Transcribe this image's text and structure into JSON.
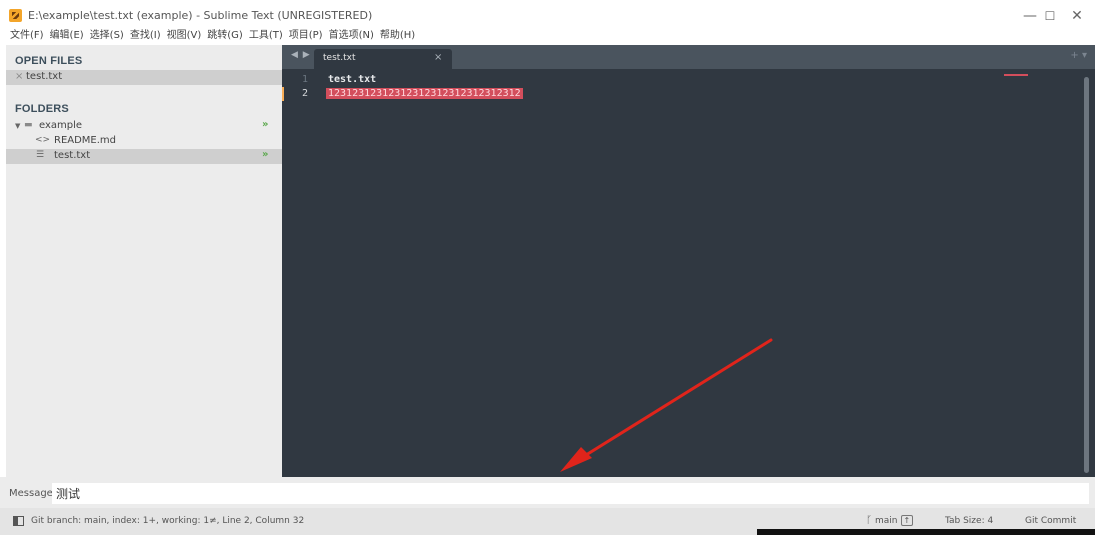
{
  "window": {
    "title": "E:\\example\\test.txt (example) - Sublime Text (UNREGISTERED)",
    "minimize": "—",
    "maximize": "☐",
    "close": "✕"
  },
  "menu": [
    "文件(F)",
    "编辑(E)",
    "选择(S)",
    "查找(I)",
    "视图(V)",
    "跳转(G)",
    "工具(T)",
    "项目(P)",
    "首选项(N)",
    "帮助(H)"
  ],
  "sidebar": {
    "open_files_header": "OPEN FILES",
    "open_file": {
      "close": "×",
      "label": "test.txt"
    },
    "folders_header": "FOLDERS",
    "tree": [
      {
        "label": "example",
        "icon": "folder-icon",
        "git": "»"
      },
      {
        "label": "README.md",
        "icon": "code-file-icon",
        "git": ""
      },
      {
        "label": "test.txt",
        "icon": "text-file-icon",
        "git": "»",
        "selected": true
      }
    ],
    "tree_glyphs": {
      "expand": "▼",
      "folder": "▬",
      "code": "<>",
      "text": "☰"
    }
  },
  "editor": {
    "tab_nav": "◀ ▶",
    "tab": {
      "label": "test.txt",
      "close": "×"
    },
    "tab_tools": "+ ▾",
    "line_numbers": [
      "1",
      "2"
    ],
    "lines": [
      "test.txt",
      "12312312312312312312312312312312"
    ],
    "current_line": 2
  },
  "message": {
    "label": "Message",
    "value": "测试"
  },
  "status": {
    "text": "Git branch: main, index: 1+, working: 1≠, Line 2, Column 32",
    "branch_icon": "ᚴ",
    "branch": "main",
    "branch_counter": "↑",
    "tab_size": "Tab Size: 4",
    "git_commit": "Git Commit"
  },
  "colors": {
    "editor_bg": "#303841",
    "tabbar_bg": "#4a545e",
    "highlight": "#d34e5c",
    "git_mark": "#5aa84b",
    "annotation_arrow": "#e0241b"
  }
}
